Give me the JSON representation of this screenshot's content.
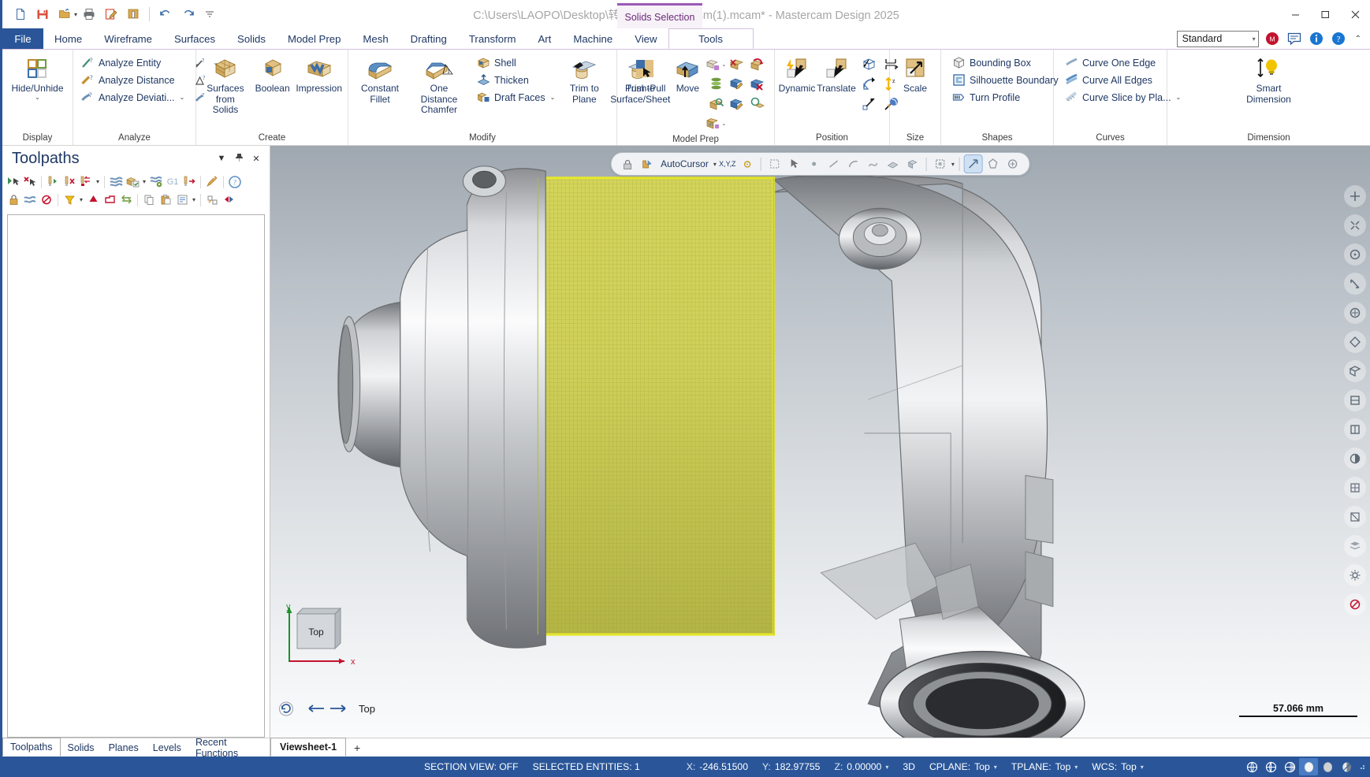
{
  "window": {
    "title": "C:\\Users\\LAOPO\\Desktop\\转换\\a072v617_asm(1).mcam* - Mastercam Design 2025",
    "minimize": "—",
    "maximize": "▢",
    "close": "✕"
  },
  "quick_access": [
    {
      "name": "new-file-icon",
      "tooltip": "New"
    },
    {
      "name": "save-icon",
      "tooltip": "Save"
    },
    {
      "name": "open-file-icon",
      "tooltip": "Open"
    },
    {
      "name": "print-icon",
      "tooltip": "Print"
    },
    {
      "name": "edit-file-icon",
      "tooltip": "Edit"
    },
    {
      "name": "file-properties-icon",
      "tooltip": "File Properties"
    },
    {
      "name": "undo-icon",
      "tooltip": "Undo"
    },
    {
      "name": "redo-icon",
      "tooltip": "Redo"
    },
    {
      "name": "qat-overflow-icon",
      "tooltip": "Customize Quick Access Toolbar"
    }
  ],
  "contextual_tab_group": {
    "label": "Solids Selection",
    "accent": "#9b59b6"
  },
  "tabs": [
    {
      "label": "File",
      "kind": "file"
    },
    {
      "label": "Home"
    },
    {
      "label": "Wireframe"
    },
    {
      "label": "Surfaces"
    },
    {
      "label": "Solids"
    },
    {
      "label": "Model Prep"
    },
    {
      "label": "Mesh"
    },
    {
      "label": "Drafting"
    },
    {
      "label": "Transform"
    },
    {
      "label": "Art"
    },
    {
      "label": "Machine"
    },
    {
      "label": "View"
    },
    {
      "label": "Tools",
      "kind": "contextual",
      "active": true
    }
  ],
  "tabstrip_right": {
    "config_value": "Standard",
    "icons": [
      {
        "name": "mymastercam-icon",
        "color": "#c4122e"
      },
      {
        "name": "chat-feedback-icon",
        "color": "#2a5699"
      },
      {
        "name": "info-icon",
        "color": "#1976d2"
      },
      {
        "name": "help-icon",
        "color": "#1976d2"
      }
    ],
    "collapse_caret": "⌃"
  },
  "ribbon": {
    "groups": [
      {
        "title": "Display",
        "big": [
          {
            "label": "Hide/Unhide",
            "icon": "hide-unhide-icon",
            "dropdown": true
          }
        ]
      },
      {
        "title": "Analyze",
        "small": [
          {
            "label": "Analyze Entity",
            "icon": "analyze-entity-icon"
          },
          {
            "label": "Analyze Distance",
            "icon": "analyze-distance-icon"
          },
          {
            "label": "Analyze Deviati...",
            "icon": "analyze-deviation-icon",
            "dropdown": true
          }
        ],
        "iconcol": [
          {
            "name": "analyze-dynamic-icon",
            "dropdown": true
          },
          {
            "name": "analyze-angle-icon"
          },
          {
            "name": "analyze-chain-icon"
          }
        ]
      },
      {
        "title": "Create",
        "big": [
          {
            "label": "Surfaces\nfrom Solids",
            "icon": "surfaces-from-solids-icon",
            "dropdown": true
          },
          {
            "label": "Boolean",
            "icon": "boolean-icon"
          },
          {
            "label": "Impression",
            "icon": "impression-icon"
          }
        ]
      },
      {
        "title": "Modify",
        "big": [
          {
            "label": "Constant\nFillet",
            "icon": "constant-fillet-icon",
            "dropdown": true
          },
          {
            "label": "One Distance\nChamfer",
            "icon": "one-distance-chamfer-icon",
            "dropdown": true
          }
        ],
        "small": [
          {
            "label": "Shell",
            "icon": "shell-icon"
          },
          {
            "label": "Thicken",
            "icon": "thicken-icon"
          },
          {
            "label": "Draft Faces",
            "icon": "draft-faces-icon",
            "dropdown": true
          }
        ],
        "big2": [
          {
            "label": "Trim to\nPlane",
            "icon": "trim-to-plane-icon"
          },
          {
            "label": "Trim to\nSurface/Sheet",
            "icon": "trim-to-surface-sheet-icon"
          }
        ]
      },
      {
        "title": "Model Prep",
        "big": [
          {
            "label": "Push-Pull",
            "icon": "push-pull-icon"
          },
          {
            "label": "Move",
            "icon": "move-icon"
          }
        ],
        "grid": [
          {
            "name": "add-feature-icon",
            "dropdown": true
          },
          {
            "name": "remove-face-icon"
          },
          {
            "name": "restore-face-icon"
          },
          {
            "name": "stack-faces-icon"
          },
          {
            "name": "modify-feature-icon"
          },
          {
            "name": "delete-face-icon"
          },
          {
            "name": "find-feature-icon"
          },
          {
            "name": "edit-solid-icon"
          },
          {
            "name": "inspect-feature-icon"
          },
          {
            "name": "feature-history-icon",
            "dropdown": true
          }
        ]
      },
      {
        "title": "Position",
        "big": [
          {
            "label": "Dynamic",
            "icon": "dynamic-move-icon"
          },
          {
            "label": "Translate",
            "icon": "translate-icon"
          }
        ],
        "grid": [
          {
            "name": "orient-icon"
          },
          {
            "name": "align-faces-icon"
          },
          {
            "name": "rotate-icon"
          },
          {
            "name": "align-z-icon"
          },
          {
            "name": "move-to-origin-icon"
          },
          {
            "name": "drag-solid-icon"
          }
        ]
      },
      {
        "title": "Size",
        "big": [
          {
            "label": "Scale",
            "icon": "scale-icon"
          }
        ]
      },
      {
        "title": "Shapes",
        "small": [
          {
            "label": "Bounding Box",
            "icon": "bounding-box-icon"
          },
          {
            "label": "Silhouette Boundary",
            "icon": "silhouette-boundary-icon"
          },
          {
            "label": "Turn Profile",
            "icon": "turn-profile-icon"
          }
        ]
      },
      {
        "title": "Curves",
        "small": [
          {
            "label": "Curve One Edge",
            "icon": "curve-one-edge-icon"
          },
          {
            "label": "Curve All Edges",
            "icon": "curve-all-edges-icon"
          },
          {
            "label": "Curve Slice by Pla...",
            "icon": "curve-slice-by-plane-icon",
            "dropdown": true
          }
        ]
      },
      {
        "title": "Dimension",
        "big": [
          {
            "label": "Smart\nDimension",
            "icon": "smart-dimension-icon"
          }
        ]
      }
    ]
  },
  "toolpaths_panel": {
    "title": "Toolpaths",
    "header_buttons": [
      {
        "name": "panel-menu-icon",
        "glyph": "▾"
      },
      {
        "name": "panel-pin-icon",
        "glyph": "📌"
      },
      {
        "name": "panel-close-icon",
        "glyph": "✕"
      }
    ],
    "toolbar_row1": [
      {
        "name": "select-all-toolpaths-icon"
      },
      {
        "name": "deselect-all-toolpaths-icon"
      },
      {
        "name": "regenerate-selected-icon"
      },
      {
        "name": "regenerate-invalid-icon"
      },
      {
        "name": "regenerate-all-dirty-icon",
        "dropdown": true
      },
      {
        "name": "simulate-toolpath-icon"
      },
      {
        "name": "verify-toolpath-icon",
        "dropdown": true
      },
      {
        "name": "backplot-icon"
      },
      {
        "name": "g1-post-icon",
        "label": "G1"
      },
      {
        "name": "post-selected-icon"
      },
      {
        "name": "high-speed-toolpath-icon"
      },
      {
        "name": "toolpath-help-icon"
      }
    ],
    "toolbar_row2": [
      {
        "name": "lock-toolpath-icon"
      },
      {
        "name": "toggle-posting-icon"
      },
      {
        "name": "toggle-display-icon"
      },
      {
        "name": "filter-toolpaths-icon",
        "dropdown": true
      },
      {
        "name": "move-up-icon"
      },
      {
        "name": "toolpath-group-icon"
      },
      {
        "name": "machine-group-icon"
      },
      {
        "name": "copy-toolpath-icon"
      },
      {
        "name": "paste-toolpath-icon"
      },
      {
        "name": "toolpath-options-icon",
        "dropdown": true
      },
      {
        "name": "expand-tree-icon"
      },
      {
        "name": "collapse-tree-icon"
      }
    ],
    "bottom_tabs": [
      {
        "label": "Toolpaths",
        "active": true
      },
      {
        "label": "Solids"
      },
      {
        "label": "Planes"
      },
      {
        "label": "Levels"
      },
      {
        "label": "Recent Functions"
      }
    ]
  },
  "graphics_toolbar": {
    "lock_icon": "autocursor-lock-icon",
    "autocursor_label": "AutoCursor",
    "autocursor_caret": "▾",
    "items": [
      {
        "name": "autocursor-axis-icon",
        "label": "X,Y,Z"
      },
      {
        "name": "autocursor-origin-icon"
      },
      {
        "name": "select-all-icon"
      },
      {
        "name": "select-arrow-icon"
      },
      {
        "name": "select-point-icon"
      },
      {
        "name": "select-line-icon"
      },
      {
        "name": "select-arc-icon"
      },
      {
        "name": "select-spline-icon"
      },
      {
        "name": "select-surface-icon"
      },
      {
        "name": "select-solid-icon"
      },
      {
        "name": "select-window-icon",
        "selected": false
      },
      {
        "name": "select-polygon-icon"
      },
      {
        "name": "select-vector-icon",
        "selected": true
      },
      {
        "name": "select-single-icon"
      },
      {
        "name": "select-verify-icon"
      }
    ]
  },
  "right_toolbar": [
    {
      "name": "fit-screen-icon",
      "glyph": "✛"
    },
    {
      "name": "zoom-window-icon",
      "glyph": "⌖"
    },
    {
      "name": "zoom-target-icon",
      "glyph": "◎"
    },
    {
      "name": "dynamic-rotate-icon",
      "glyph": "⟳"
    },
    {
      "name": "pan-icon",
      "glyph": "✥"
    },
    {
      "name": "isometric-view-icon",
      "glyph": "⬡"
    },
    {
      "name": "top-view-icon",
      "glyph": "▣"
    },
    {
      "name": "front-view-icon",
      "glyph": "▤"
    },
    {
      "name": "right-view-icon",
      "glyph": "▥"
    },
    {
      "name": "shaded-view-icon",
      "glyph": "◧"
    },
    {
      "name": "wireframe-view-icon",
      "glyph": "▦"
    },
    {
      "name": "section-view-icon",
      "glyph": "◫"
    },
    {
      "name": "levels-visibility-icon",
      "glyph": "≡"
    },
    {
      "name": "view-settings-icon",
      "glyph": "⚙"
    },
    {
      "name": "blank-entities-icon",
      "glyph": "⊘"
    }
  ],
  "gnomon": {
    "label": "Top",
    "axis_x": "x",
    "axis_y": "y"
  },
  "viewsheet_controls": {
    "undo_view_icon": "undo-view-icon",
    "prev_view_icon": "previous-view-icon",
    "next_view_icon": "next-view-icon",
    "view_name": "Top"
  },
  "scale_bar": {
    "value": "57.066 mm"
  },
  "viewsheets": {
    "tabs": [
      {
        "label": "Viewsheet-1",
        "active": true
      }
    ],
    "add": "+"
  },
  "status_bar": {
    "section_view": "SECTION VIEW: OFF",
    "selected_entities": "SELECTED ENTITIES: 1",
    "coords": [
      {
        "key": "X:",
        "value": "-246.51500"
      },
      {
        "key": "Y:",
        "value": "182.97755"
      },
      {
        "key": "Z:",
        "value": "0.00000",
        "caret": "▾"
      }
    ],
    "mode_3d": "3D",
    "planes": [
      {
        "key": "CPLANE:",
        "value": "Top",
        "caret": "▾"
      },
      {
        "key": "TPLANE:",
        "value": "Top",
        "caret": "▾"
      },
      {
        "key": "WCS:",
        "value": "Top",
        "caret": "▾"
      }
    ],
    "right_icons": [
      {
        "name": "wireframe-shade-icon",
        "glyph": "⊕"
      },
      {
        "name": "hidden-line-icon",
        "glyph": "⊕"
      },
      {
        "name": "shaded-half-icon",
        "glyph": "◔"
      },
      {
        "name": "shaded-solid-icon",
        "glyph": "⬤",
        "active": true
      },
      {
        "name": "shaded-with-edges-icon",
        "glyph": "⬤"
      },
      {
        "name": "translucent-icon",
        "glyph": "◑"
      }
    ],
    "resize_grip": "resize-grip-icon"
  },
  "colors": {
    "accent_blue": "#2a5699",
    "contextual_purple": "#9b59b6",
    "selection_yellow": "#d9d94a",
    "text_blue": "#1f3864"
  }
}
